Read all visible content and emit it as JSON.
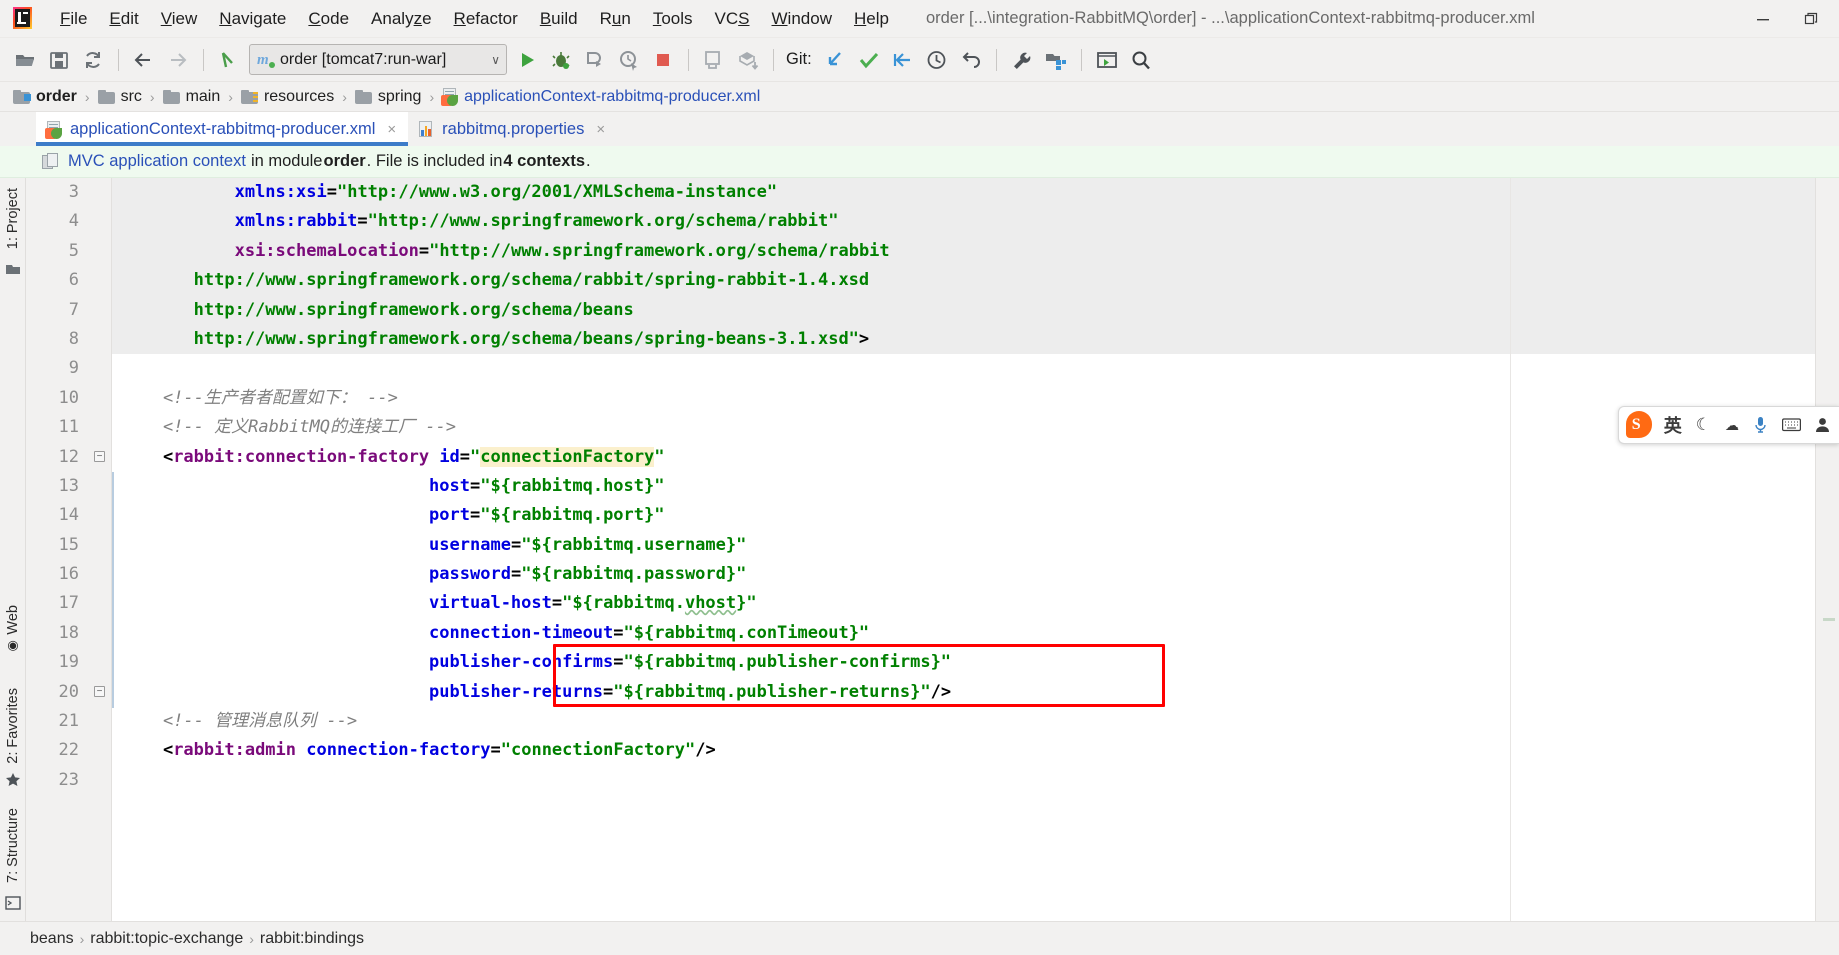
{
  "window": {
    "title": "order [...\\integration-RabbitMQ\\order] - ...\\applicationContext-rabbitmq-producer.xml",
    "minimize_label": "—",
    "restore_label": "❐"
  },
  "menu": {
    "items": [
      {
        "label": "File"
      },
      {
        "label": "Edit"
      },
      {
        "label": "View"
      },
      {
        "label": "Navigate"
      },
      {
        "label": "Code"
      },
      {
        "label": "Analyze"
      },
      {
        "label": "Refactor"
      },
      {
        "label": "Build"
      },
      {
        "label": "Run"
      },
      {
        "label": "Tools"
      },
      {
        "label": "VCS"
      },
      {
        "label": "Window"
      },
      {
        "label": "Help"
      }
    ]
  },
  "toolbar": {
    "run_config": {
      "label": "order [tomcat7:run-war]",
      "caret": "∨"
    },
    "git_label": "Git:"
  },
  "path_breadcrumb": {
    "items": [
      {
        "label": "order",
        "type": "module"
      },
      {
        "label": "src",
        "type": "folder"
      },
      {
        "label": "main",
        "type": "folder"
      },
      {
        "label": "resources",
        "type": "resources"
      },
      {
        "label": "spring",
        "type": "folder"
      },
      {
        "label": "applicationContext-rabbitmq-producer.xml",
        "type": "file"
      }
    ],
    "separator": "›"
  },
  "tabs": [
    {
      "label": "applicationContext-rabbitmq-producer.xml",
      "icon": "xml-file-icon",
      "active": true,
      "close": "×"
    },
    {
      "label": "rabbitmq.properties",
      "icon": "properties-file-icon",
      "active": false,
      "close": "×"
    }
  ],
  "banner": {
    "link_text": "MVC application context",
    "mid_text": " in module ",
    "module": "order",
    "tail_text": ". File is included in ",
    "contexts": "4 contexts",
    "period": "."
  },
  "left_tools": [
    {
      "label": "1: Project"
    },
    {
      "label": "Web"
    },
    {
      "label": "2: Favorites"
    },
    {
      "label": "7: Structure"
    }
  ],
  "editor": {
    "line_numbers": [
      "3",
      "4",
      "5",
      "6",
      "7",
      "8",
      "9",
      "10",
      "11",
      "12",
      "13",
      "14",
      "15",
      "16",
      "17",
      "18",
      "19",
      "20",
      "21",
      "22",
      "23"
    ],
    "lines": [
      {
        "num": "3",
        "indent": 0,
        "highlight": true,
        "segments": [
          {
            "t": "           ",
            "c": "k-punct"
          },
          {
            "t": "xmlns:xsi",
            "c": "k-attr"
          },
          {
            "t": "=",
            "c": "k-punct"
          },
          {
            "t": "\"http://www.w3.org/2001/XMLSchema-instance\"",
            "c": "k-val"
          }
        ]
      },
      {
        "num": "4",
        "indent": 0,
        "highlight": true,
        "segments": [
          {
            "t": "           ",
            "c": "k-punct"
          },
          {
            "t": "xmlns:rabbit",
            "c": "k-attr"
          },
          {
            "t": "=",
            "c": "k-punct"
          },
          {
            "t": "\"http://www.springframework.org/schema/rabbit\"",
            "c": "k-val"
          }
        ]
      },
      {
        "num": "5",
        "indent": 0,
        "highlight": true,
        "segments": [
          {
            "t": "           ",
            "c": "k-punct"
          },
          {
            "t": "xsi:schemaLocation",
            "c": "k-ns"
          },
          {
            "t": "=",
            "c": "k-punct"
          },
          {
            "t": "\"http://www.springframework.org/schema/rabbit",
            "c": "k-val"
          }
        ]
      },
      {
        "num": "6",
        "indent": 0,
        "highlight": true,
        "segments": [
          {
            "t": "       http://www.springframework.org/schema/rabbit/spring-rabbit-1.4.xsd",
            "c": "k-val"
          }
        ]
      },
      {
        "num": "7",
        "indent": 0,
        "highlight": true,
        "segments": [
          {
            "t": "       http://www.springframework.org/schema/beans",
            "c": "k-val"
          }
        ]
      },
      {
        "num": "8",
        "indent": 0,
        "highlight": true,
        "segments": [
          {
            "t": "       http://www.springframework.org/schema/beans/spring-beans-3.1.xsd\"",
            "c": "k-val"
          },
          {
            "t": ">",
            "c": "k-punct"
          }
        ]
      },
      {
        "num": "9",
        "indent": 0,
        "highlight": false,
        "segments": []
      },
      {
        "num": "10",
        "indent": 0,
        "highlight": false,
        "segments": [
          {
            "t": "    <!--生产者者配置如下： -->",
            "c": "k-cmt"
          }
        ]
      },
      {
        "num": "11",
        "indent": 0,
        "highlight": false,
        "segments": [
          {
            "t": "    <!-- 定义RabbitMQ的连接工厂 -->",
            "c": "k-cmt"
          }
        ]
      },
      {
        "num": "12",
        "indent": 0,
        "highlight": false,
        "segments": [
          {
            "t": "    ",
            "c": "k-punct"
          },
          {
            "t": "<",
            "c": "k-punct"
          },
          {
            "t": "rabbit:connection-factory",
            "c": "k-ns"
          },
          {
            "t": " ",
            "c": "k-punct"
          },
          {
            "t": "id",
            "c": "k-attr"
          },
          {
            "t": "=",
            "c": "k-punct"
          },
          {
            "t": "\"",
            "c": "k-val"
          },
          {
            "t": "connectionFactory",
            "c": "k-hl-id"
          },
          {
            "t": "\"",
            "c": "k-val"
          }
        ]
      },
      {
        "num": "13",
        "indent": 0,
        "highlight": false,
        "segments": [
          {
            "t": "                              ",
            "c": "k-punct"
          },
          {
            "t": "host",
            "c": "k-attr"
          },
          {
            "t": "=",
            "c": "k-punct"
          },
          {
            "t": "\"${rabbitmq.host}\"",
            "c": "k-val"
          }
        ]
      },
      {
        "num": "14",
        "indent": 0,
        "highlight": false,
        "segments": [
          {
            "t": "                              ",
            "c": "k-punct"
          },
          {
            "t": "port",
            "c": "k-attr"
          },
          {
            "t": "=",
            "c": "k-punct"
          },
          {
            "t": "\"${rabbitmq.port}\"",
            "c": "k-val"
          }
        ]
      },
      {
        "num": "15",
        "indent": 0,
        "highlight": false,
        "segments": [
          {
            "t": "                              ",
            "c": "k-punct"
          },
          {
            "t": "username",
            "c": "k-attr"
          },
          {
            "t": "=",
            "c": "k-punct"
          },
          {
            "t": "\"${rabbitmq.username}\"",
            "c": "k-val"
          }
        ]
      },
      {
        "num": "16",
        "indent": 0,
        "highlight": false,
        "segments": [
          {
            "t": "                              ",
            "c": "k-punct"
          },
          {
            "t": "password",
            "c": "k-attr"
          },
          {
            "t": "=",
            "c": "k-punct"
          },
          {
            "t": "\"${rabbitmq.password}\"",
            "c": "k-val"
          }
        ]
      },
      {
        "num": "17",
        "indent": 0,
        "highlight": false,
        "segments": [
          {
            "t": "                              ",
            "c": "k-punct"
          },
          {
            "t": "virtual-host",
            "c": "k-attr"
          },
          {
            "t": "=",
            "c": "k-punct"
          },
          {
            "t": "\"${rabbitmq.vhost}\"",
            "c": "k-val"
          }
        ]
      },
      {
        "num": "18",
        "indent": 0,
        "highlight": false,
        "segments": [
          {
            "t": "                              ",
            "c": "k-punct"
          },
          {
            "t": "connection-timeout",
            "c": "k-attr"
          },
          {
            "t": "=",
            "c": "k-punct"
          },
          {
            "t": "\"${rabbitmq.conTimeout}\"",
            "c": "k-val"
          }
        ]
      },
      {
        "num": "19",
        "indent": 0,
        "highlight": false,
        "segments": [
          {
            "t": "                              ",
            "c": "k-punct"
          },
          {
            "t": "publisher-confirms",
            "c": "k-attr"
          },
          {
            "t": "=",
            "c": "k-punct"
          },
          {
            "t": "\"${rabbitmq.publisher-confirms}\"",
            "c": "k-val"
          }
        ]
      },
      {
        "num": "20",
        "indent": 0,
        "highlight": false,
        "segments": [
          {
            "t": "                              ",
            "c": "k-punct"
          },
          {
            "t": "publisher-returns",
            "c": "k-attr"
          },
          {
            "t": "=",
            "c": "k-punct"
          },
          {
            "t": "\"${rabbitmq.publisher-returns}\"",
            "c": "k-val"
          },
          {
            "t": "/>",
            "c": "k-punct"
          }
        ]
      },
      {
        "num": "21",
        "indent": 0,
        "highlight": false,
        "segments": [
          {
            "t": "    <!-- 管理消息队列 -->",
            "c": "k-cmt"
          }
        ]
      },
      {
        "num": "22",
        "indent": 0,
        "highlight": false,
        "segments": [
          {
            "t": "    ",
            "c": "k-punct"
          },
          {
            "t": "<",
            "c": "k-punct"
          },
          {
            "t": "rabbit:admin",
            "c": "k-ns"
          },
          {
            "t": " ",
            "c": "k-punct"
          },
          {
            "t": "connection-factory",
            "c": "k-attr"
          },
          {
            "t": "=",
            "c": "k-punct"
          },
          {
            "t": "\"connectionFactory\"",
            "c": "k-val"
          },
          {
            "t": "/>",
            "c": "k-punct"
          }
        ]
      },
      {
        "num": "23",
        "indent": 0,
        "highlight": false,
        "segments": []
      }
    ]
  },
  "annotation": {
    "type": "red-rectangle",
    "color": "#ff0000",
    "covers_lines": [
      "19",
      "20"
    ]
  },
  "ime": {
    "logo_char": "S",
    "mode": "英",
    "items": [
      "moon-icon",
      "weather-icon",
      "mic-icon",
      "keyboard-icon",
      "user-icon"
    ]
  },
  "bottom_breadcrumb": {
    "items": [
      "beans",
      "rabbit:topic-exchange",
      "rabbit:bindings"
    ],
    "separator": "›"
  },
  "colors": {
    "accent": "#3d7cc9",
    "link": "#2a50b8",
    "banner_bg": "#effaef",
    "annotation": "#ff0000",
    "xml_value": "#008000",
    "xml_attr": "#0000e0",
    "xml_tag": "#7a0a7a",
    "comment": "#808080",
    "highlight_bg": "#ededed",
    "id_highlight": "#fbf0cd"
  }
}
